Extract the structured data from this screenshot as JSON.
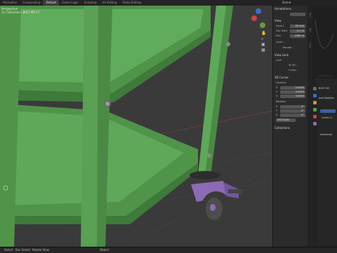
{
  "topbar": {
    "tabs": [
      "Animation",
      "Compositing",
      "Default",
      "Game Logic",
      "Scripting",
      "UV Editing",
      "Video Editing"
    ],
    "active_index": 2,
    "scene_label": "Scene"
  },
  "viewport": {
    "view_name": "Perspective",
    "collection": "(1) Collection | BOLT M5 17"
  },
  "npanel": {
    "annotations": "Annotations",
    "annotations_value": "",
    "view_header": "View",
    "focal_label": "Focal L",
    "focal_value": "50 mm",
    "clip_start_label": "Clip Start",
    "clip_start_value": "0.1 m",
    "clip_end_label": "End",
    "clip_end_value": "1000 m",
    "local_label": "Local ...",
    "render_label": "Render ...",
    "view_lock_header": "View Lock",
    "lock_label": "Lock",
    "to_3d_label": "To 3D ...",
    "cursor_lock_label": "Curso...",
    "cursor_header": "3D Cursor",
    "location_label": "Location",
    "x_label": "X",
    "x_value": "0.0000",
    "y_label": "Y",
    "y_value": "0.0000",
    "z_label": "Z",
    "z_value": "0.0000",
    "rotation_label": "Rotation",
    "rx_label": "X",
    "rx_value": "0°",
    "ry_label": "Y",
    "ry_value": "0°",
    "rz_label": "Z",
    "rz_value": "0°",
    "rotation_mode": "XYZ Euler",
    "collections_header": "Collections"
  },
  "ntabs": [
    "Item",
    "Tool",
    "View"
  ],
  "right_panel": {
    "object_name": "BOLT M5",
    "add_modifier": "Add Modifier",
    "levels_label": "Levels V...",
    "advanced_label": "Advanced"
  },
  "statusbar": {
    "select": "Select",
    "box_select": "Box Select",
    "rotate_view": "Rotate View",
    "object": "Object"
  },
  "colors": {
    "cart_green": "#5fa85a",
    "caster_purple": "#8b6bb5",
    "wheel_dark": "#3a3a3a"
  },
  "icons": [
    "hand-icon",
    "zoom-icon",
    "camera-icon",
    "grid-icon",
    "gear-icon",
    "wrench-icon"
  ]
}
